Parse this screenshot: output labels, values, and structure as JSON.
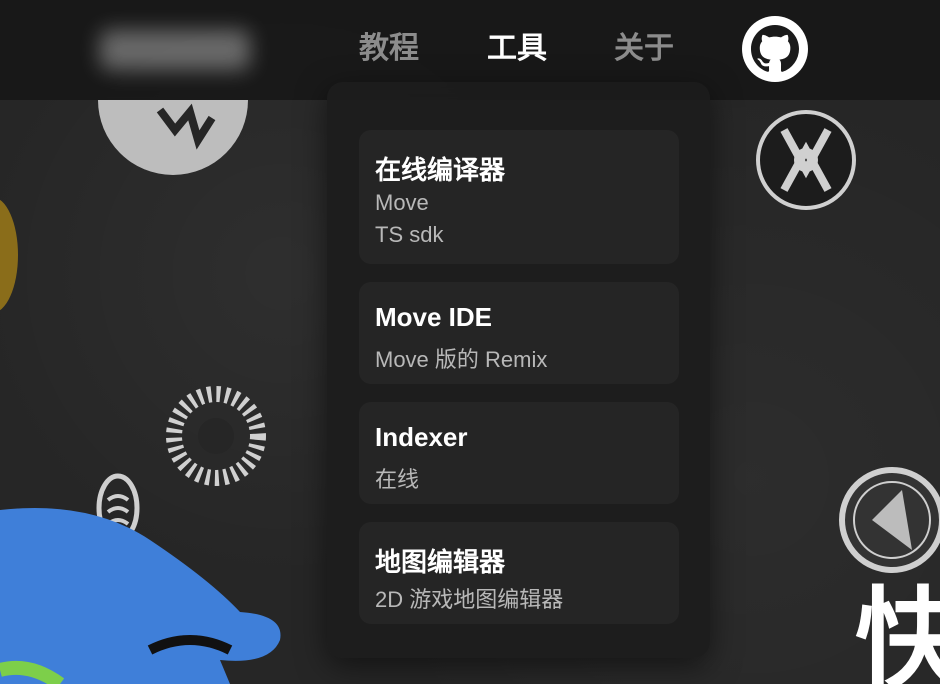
{
  "nav": {
    "items": [
      {
        "label": "教程",
        "active": false
      },
      {
        "label": "工具",
        "active": true
      },
      {
        "label": "关于",
        "active": false
      }
    ],
    "github_icon": "github-icon"
  },
  "dropdown": {
    "items": [
      {
        "title": "在线编译器",
        "lines": [
          "Move",
          "TS sdk"
        ]
      },
      {
        "title": "Move IDE",
        "lines": [
          "Move 版的 Remix"
        ]
      },
      {
        "title": "Indexer",
        "lines": [
          "在线"
        ]
      },
      {
        "title": "地图编辑器",
        "lines": [
          "2D 游戏地图编辑器"
        ]
      }
    ]
  },
  "background": {
    "corner_char": "快"
  },
  "colors": {
    "active_nav": "#ffffff",
    "inactive_nav": "#8c8c8c",
    "menu_bg": "#1c1c1c",
    "mascot_blue": "#3f7fd9"
  }
}
